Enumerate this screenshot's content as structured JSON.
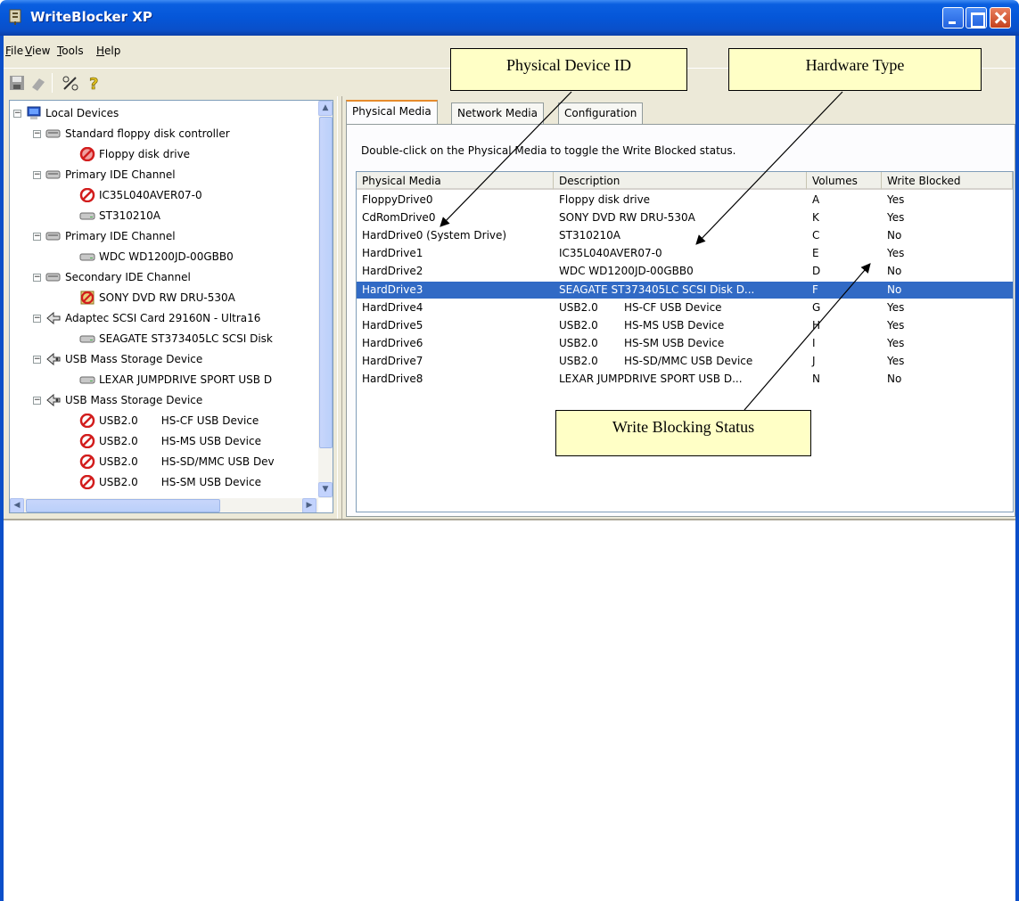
{
  "window": {
    "title": "WriteBlocker XP"
  },
  "menu": [
    {
      "label_pre": "",
      "label_ul": "F",
      "label_post": "ile"
    },
    {
      "label_pre": "",
      "label_ul": "V",
      "label_post": "iew"
    },
    {
      "label_pre": "",
      "label_ul": "T",
      "label_post": "ools"
    },
    {
      "label_pre": "",
      "label_ul": "H",
      "label_post": "elp"
    }
  ],
  "tree": {
    "root": "Local Devices",
    "nodes": [
      {
        "label": "Standard floppy disk controller",
        "level": 1,
        "icon": "controller-icon"
      },
      {
        "label": "Floppy disk drive",
        "level": 2,
        "icon": "floppy-blocked-icon"
      },
      {
        "label": "Primary IDE Channel",
        "level": 1,
        "icon": "controller-icon"
      },
      {
        "label": "IC35L040AVER07-0",
        "level": 2,
        "icon": "blocked-icon"
      },
      {
        "label": "ST310210A",
        "level": 2,
        "icon": "disk-icon"
      },
      {
        "label": "Primary IDE Channel",
        "level": 1,
        "icon": "controller-icon"
      },
      {
        "label": "WDC WD1200JD-00GBB0",
        "level": 2,
        "icon": "disk-icon"
      },
      {
        "label": "Secondary IDE Channel",
        "level": 1,
        "icon": "controller-icon"
      },
      {
        "label": "SONY DVD RW DRU-530A",
        "level": 2,
        "icon": "cdrom-blocked-icon"
      },
      {
        "label": "Adaptec SCSI Card 29160N - Ultra16",
        "level": 1,
        "icon": "scsi-icon"
      },
      {
        "label": "SEAGATE ST373405LC SCSI Disk",
        "level": 2,
        "icon": "disk-icon"
      },
      {
        "label": "USB Mass Storage Device",
        "level": 1,
        "icon": "usb-icon"
      },
      {
        "label": "LEXAR JUMPDRIVE SPORT USB D",
        "level": 2,
        "icon": "disk-icon"
      },
      {
        "label": "USB Mass Storage Device",
        "level": 1,
        "icon": "usb-icon"
      },
      {
        "label": "USB2.0",
        "extra": "HS-CF USB Device",
        "level": 2,
        "icon": "blocked-icon"
      },
      {
        "label": "USB2.0",
        "extra": "HS-MS USB Device",
        "level": 2,
        "icon": "blocked-icon"
      },
      {
        "label": "USB2.0",
        "extra": "HS-SD/MMC USB Dev",
        "level": 2,
        "icon": "blocked-icon"
      },
      {
        "label": "USB2.0",
        "extra": "HS-SM USB Device",
        "level": 2,
        "icon": "blocked-icon"
      }
    ]
  },
  "tabs": [
    "Physical Media",
    "Network Media",
    "Configuration"
  ],
  "hint": "Double-click on the Physical Media to toggle the Write Blocked status.",
  "list": {
    "columns": [
      "Physical Media",
      "Description",
      "Volumes",
      "Write Blocked"
    ],
    "rows": [
      {
        "media": "FloppyDrive0",
        "desc": "Floppy disk drive",
        "desc2": "",
        "vol": "A",
        "blocked": "Yes"
      },
      {
        "media": "CdRomDrive0",
        "desc": "SONY DVD RW DRU-530A",
        "desc2": "",
        "vol": "K",
        "blocked": "Yes"
      },
      {
        "media": "HardDrive0 (System Drive)",
        "desc": "ST310210A",
        "desc2": "",
        "vol": "C",
        "blocked": "No"
      },
      {
        "media": "HardDrive1",
        "desc": "IC35L040AVER07-0",
        "desc2": "",
        "vol": "E",
        "blocked": "Yes"
      },
      {
        "media": "HardDrive2",
        "desc": "WDC WD1200JD-00GBB0",
        "desc2": "",
        "vol": "D",
        "blocked": "No"
      },
      {
        "media": "HardDrive3",
        "desc": "SEAGATE ST373405LC SCSI Disk D...",
        "desc2": "",
        "vol": "F",
        "blocked": "No",
        "selected": true
      },
      {
        "media": "HardDrive4",
        "desc": "USB2.0",
        "desc2": "HS-CF USB Device",
        "vol": "G",
        "blocked": "Yes"
      },
      {
        "media": "HardDrive5",
        "desc": "USB2.0",
        "desc2": "HS-MS USB Device",
        "vol": "H",
        "blocked": "Yes"
      },
      {
        "media": "HardDrive6",
        "desc": "USB2.0",
        "desc2": "HS-SM USB Device",
        "vol": "I",
        "blocked": "Yes"
      },
      {
        "media": "HardDrive7",
        "desc": "USB2.0",
        "desc2": "HS-SD/MMC USB Device",
        "vol": "J",
        "blocked": "Yes"
      },
      {
        "media": "HardDrive8",
        "desc": "LEXAR JUMPDRIVE SPORT USB D...",
        "desc2": "",
        "vol": "N",
        "blocked": "No"
      }
    ]
  },
  "callouts": {
    "device_id": "Physical Device ID",
    "hardware_type": "Hardware Type",
    "write_status": "Write Blocking Status"
  },
  "colors": {
    "selection": "#316ac5",
    "callout_bg": "#ffffc6",
    "titlebar": "#0556d8"
  }
}
